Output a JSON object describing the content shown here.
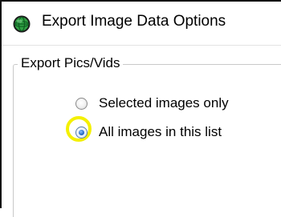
{
  "window": {
    "title": "Export Image Data Options",
    "icon": "globe-icon"
  },
  "group": {
    "legend": "Export Pics/Vids"
  },
  "options": [
    {
      "label": "Selected images only",
      "selected": false
    },
    {
      "label": "All images in this list",
      "selected": true
    }
  ],
  "colors": {
    "highlight_ring": "#f4f000",
    "radio_dot": "#2a6fc9",
    "icon_green": "#2fa043"
  }
}
